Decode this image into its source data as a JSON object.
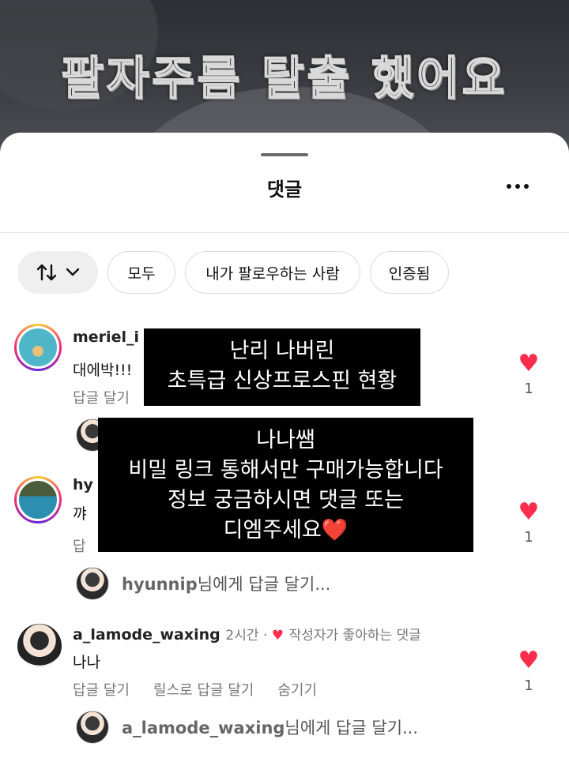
{
  "video": {
    "title": "팔자주름 탈출 했어요"
  },
  "sheet": {
    "title": "댓글",
    "more_icon": "more-horizontal-icon"
  },
  "filters": {
    "sort_icon": "sort-arrows-icon",
    "chevron_icon": "chevron-down-icon",
    "all": "모두",
    "following": "내가 팔로우하는 사람",
    "verified": "인증됨"
  },
  "comments": [
    {
      "username": "meriel_i",
      "text": "대에박!!!",
      "reply_label": "답글 달기",
      "likes": "1"
    },
    {
      "username": "hy",
      "text": "꺄",
      "reply_label": "답",
      "likes": "1",
      "reply_to": "hyunnip",
      "reply_suffix": "님에게 답글 달기..."
    },
    {
      "username": "a_lamode_waxing",
      "time": "2시간",
      "sep": " · ",
      "liked_by_author": "작성자가 좋아하는 댓글",
      "text": "나나",
      "reply_label": "답글 달기",
      "reels_reply_label": "릴스로 답글 달기",
      "hide_label": "숨기기",
      "likes": "1",
      "reply_to": "a_lamode_waxing",
      "reply_suffix": "님에게 답글 달기..."
    }
  ],
  "overlays": [
    {
      "lines": [
        "난리 나버린",
        "초특급 신상프로스핀 현황"
      ]
    },
    {
      "lines": [
        "나나쌤",
        "비밀 링크 통해서만 구매가능합니다",
        "정보 궁금하시면 댓글 또는",
        "디엠주세요"
      ],
      "emoji": "❤️"
    }
  ],
  "colors": {
    "heart": "#ff2d4c",
    "accent_text": "#777777"
  }
}
